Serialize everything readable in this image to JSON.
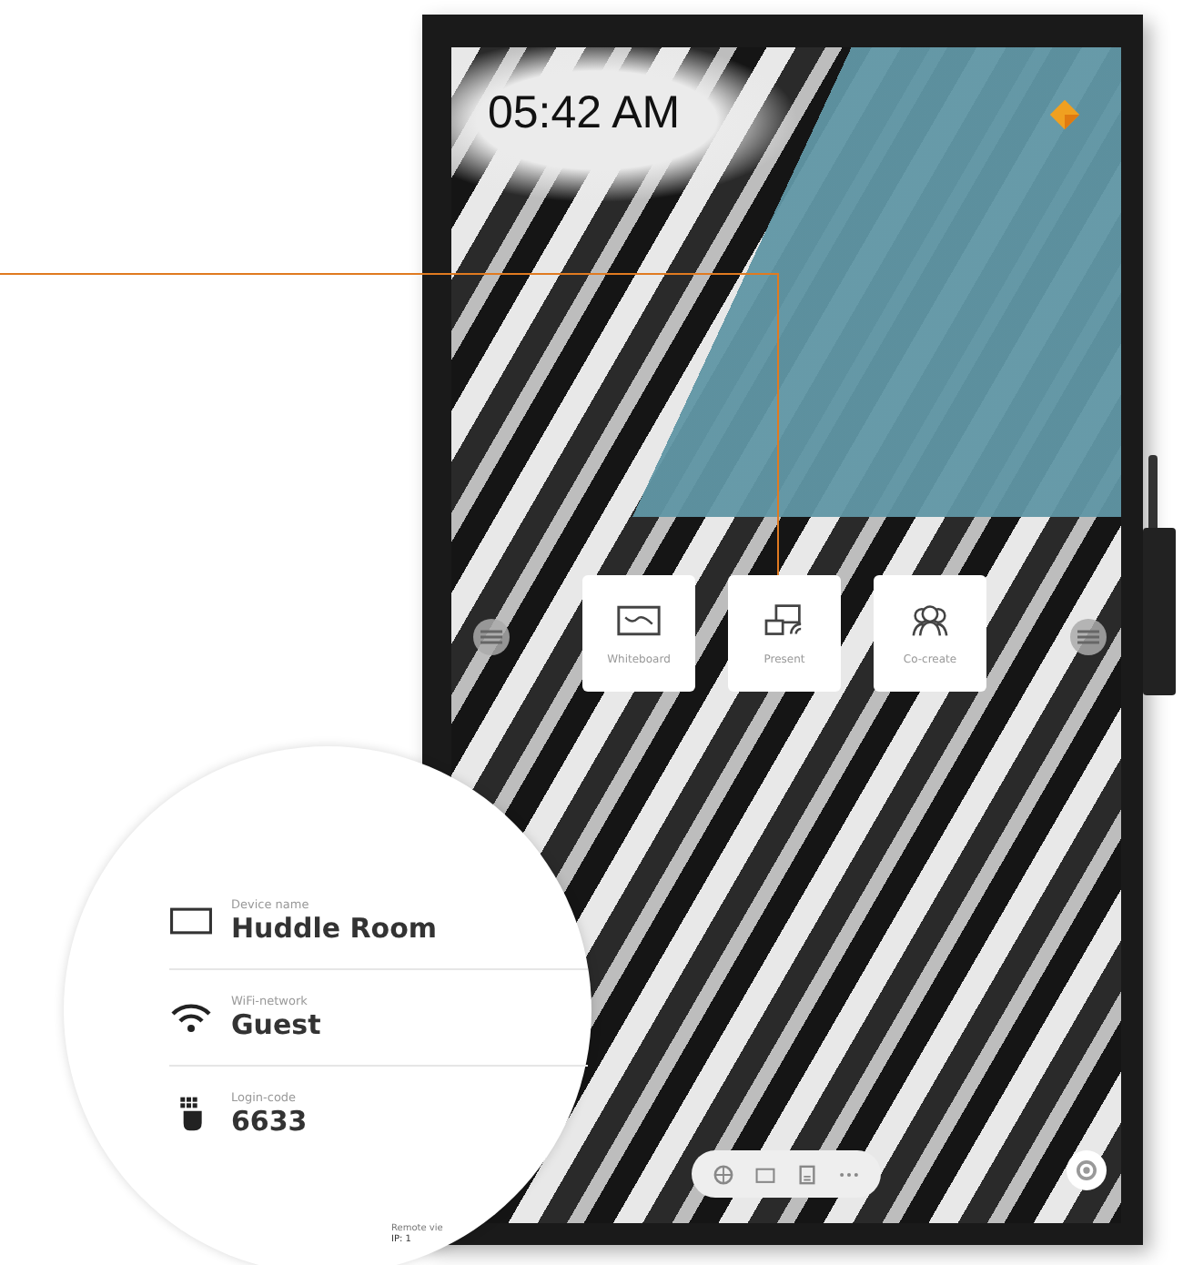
{
  "clock": {
    "time": "05:42 AM"
  },
  "tiles": [
    {
      "kind": "whiteboard",
      "label": "Whiteboard"
    },
    {
      "kind": "present",
      "label": "Present"
    },
    {
      "kind": "cocreate",
      "label": "Co-create"
    }
  ],
  "info": [
    {
      "kind": "device",
      "label": "Device name",
      "value": "Huddle Room"
    },
    {
      "kind": "wifi",
      "label": "WiFi-network",
      "value": "Guest"
    },
    {
      "kind": "code",
      "label": "Login-code",
      "value": "6633"
    }
  ],
  "remote": {
    "label": "Remote vie",
    "ip": "IP: 1"
  }
}
